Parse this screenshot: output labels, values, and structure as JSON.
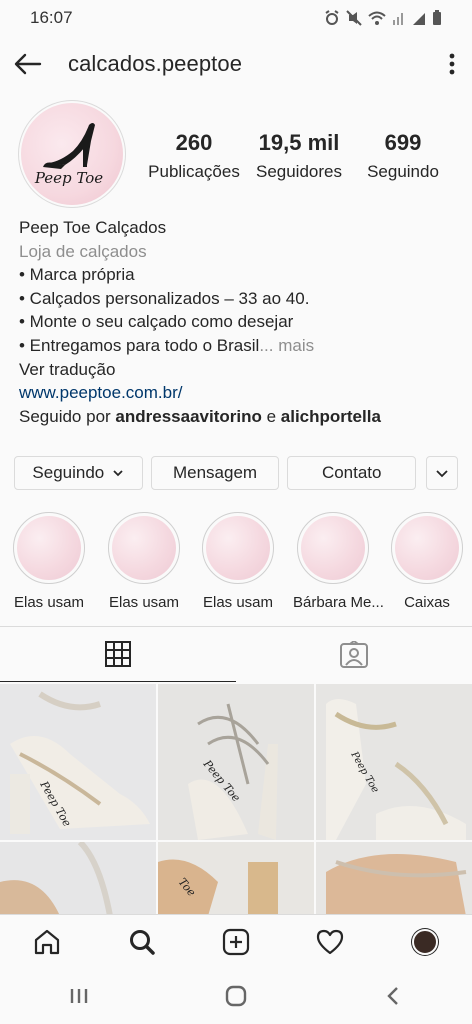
{
  "status_bar": {
    "time": "16:07"
  },
  "header": {
    "username": "calcados.peeptoe"
  },
  "profile": {
    "avatar_text": "Peep Toe",
    "stats": [
      {
        "value": "260",
        "label": "Publicações"
      },
      {
        "value": "19,5 mil",
        "label": "Seguidores"
      },
      {
        "value": "699",
        "label": "Seguindo"
      }
    ]
  },
  "bio": {
    "name": "Peep Toe Calçados",
    "category": "Loja de calçados",
    "lines": [
      "• Marca própria",
      "• Calçados personalizados – 33 ao 40.",
      "• Monte o seu calçado como desejar",
      "• Entregamos para todo o Brasil"
    ],
    "more": "... mais",
    "translate": "Ver tradução",
    "website": "www.peeptoe.com.br/",
    "followed_prefix": "Seguido por ",
    "followed_user_1": "andressaavitorino",
    "followed_joiner": " e ",
    "followed_user_2": "alichportella"
  },
  "actions": {
    "following": "Seguindo",
    "message": "Mensagem",
    "contact": "Contato"
  },
  "highlights": [
    {
      "label": "Elas usam"
    },
    {
      "label": "Elas usam"
    },
    {
      "label": "Elas usam"
    },
    {
      "label": "Bárbara Me..."
    },
    {
      "label": "Caixas"
    }
  ],
  "grid_cells": [
    {
      "brand_text": "Peep Toe"
    },
    {
      "brand_text": "Peep Toe"
    },
    {
      "brand_text": "Peep Toe"
    },
    {
      "brand_text": ""
    },
    {
      "brand_text": "Toe"
    },
    {
      "brand_text": ""
    }
  ],
  "colors": {
    "link": "#00376b",
    "secondary_text": "#8e8e8e",
    "highlight_pink": "#f5d9e0"
  }
}
